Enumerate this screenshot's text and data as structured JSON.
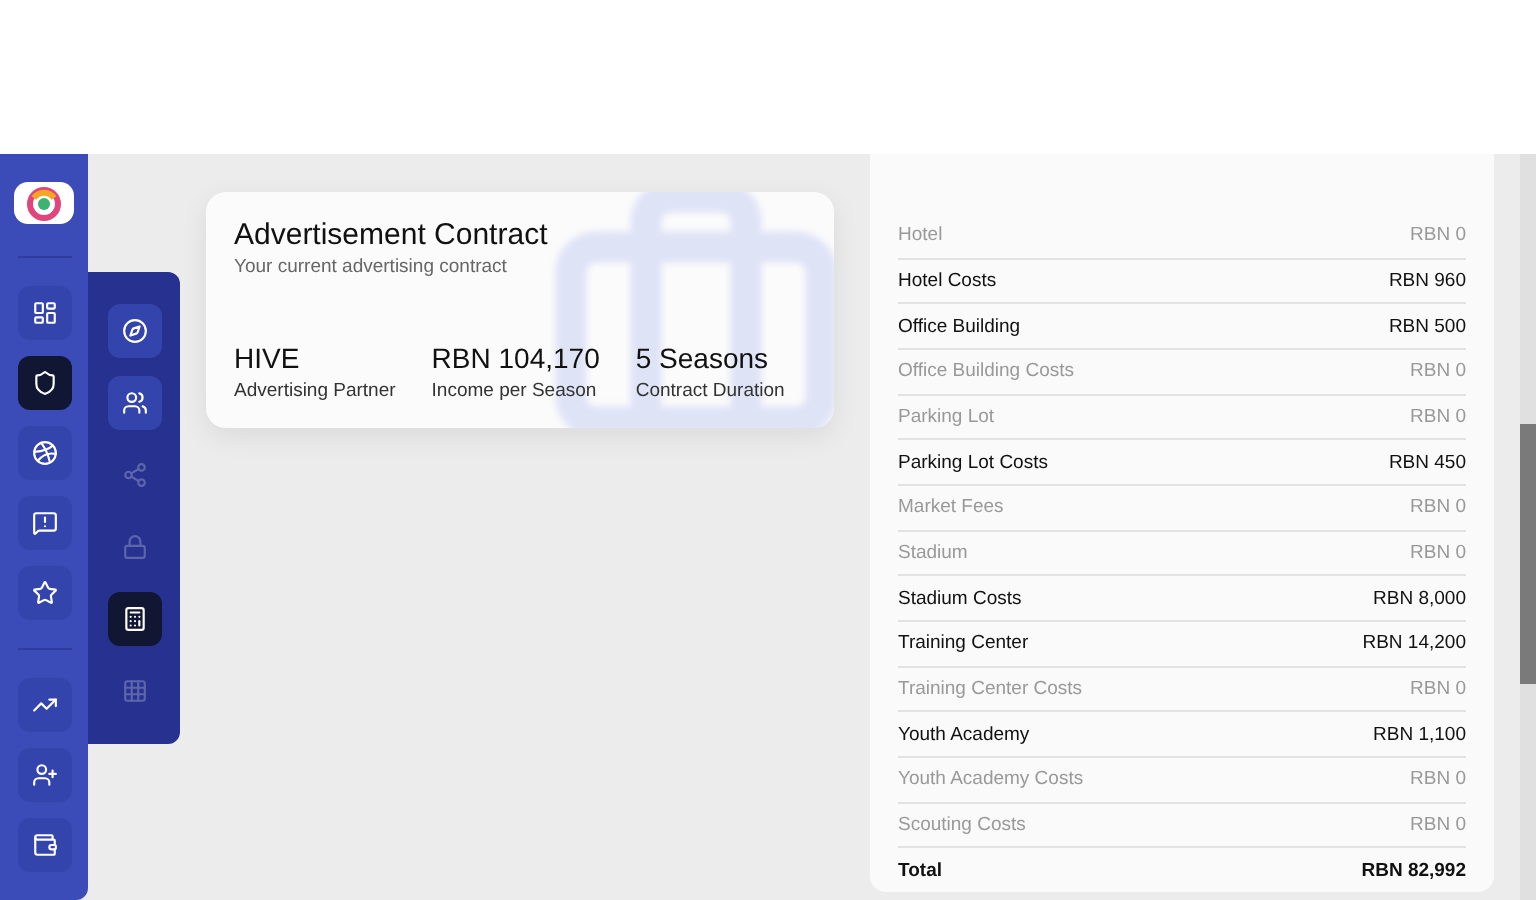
{
  "sidebar": {
    "items": [
      {
        "kind": "dashboard",
        "selected": false
      },
      {
        "kind": "shield",
        "selected": true
      },
      {
        "kind": "ball",
        "selected": false
      },
      {
        "kind": "alert",
        "selected": false
      },
      {
        "kind": "star",
        "selected": false
      },
      {
        "kind": "trend",
        "selected": false
      },
      {
        "kind": "adduser",
        "selected": false
      },
      {
        "kind": "wallet",
        "selected": false
      }
    ]
  },
  "submenu": {
    "items": [
      {
        "kind": "compass",
        "selected": false,
        "disabled": false
      },
      {
        "kind": "users",
        "selected": false,
        "disabled": false
      },
      {
        "kind": "share",
        "selected": false,
        "disabled": true
      },
      {
        "kind": "lock",
        "selected": false,
        "disabled": true
      },
      {
        "kind": "calculator",
        "selected": true,
        "disabled": false
      },
      {
        "kind": "grid",
        "selected": false,
        "disabled": true
      }
    ]
  },
  "contract": {
    "title": "Advertisement Contract",
    "subtitle": "Your current advertising contract",
    "stats": [
      {
        "value": "HIVE",
        "label": "Advertising Partner"
      },
      {
        "value": "RBN 104,170",
        "label": "Income per Season"
      },
      {
        "value": "5 Seasons",
        "label": "Contract Duration"
      }
    ]
  },
  "costs": {
    "rows": [
      {
        "kind": "item",
        "label": "Hotel",
        "value": "RBN 0",
        "dimmed": true
      },
      {
        "kind": "item",
        "label": "Hotel Costs",
        "value": "RBN 960",
        "dimmed": false
      },
      {
        "kind": "item",
        "label": "Office Building",
        "value": "RBN 500",
        "dimmed": false
      },
      {
        "kind": "item",
        "label": "Office Building Costs",
        "value": "RBN 0",
        "dimmed": true
      },
      {
        "kind": "item",
        "label": "Parking Lot",
        "value": "RBN 0",
        "dimmed": true
      },
      {
        "kind": "item",
        "label": "Parking Lot Costs",
        "value": "RBN 450",
        "dimmed": false
      },
      {
        "kind": "item",
        "label": "Market Fees",
        "value": "RBN 0",
        "dimmed": true
      },
      {
        "kind": "item",
        "label": "Stadium",
        "value": "RBN 0",
        "dimmed": true
      },
      {
        "kind": "item",
        "label": "Stadium Costs",
        "value": "RBN 8,000",
        "dimmed": false
      },
      {
        "kind": "item",
        "label": "Training Center",
        "value": "RBN 14,200",
        "dimmed": false
      },
      {
        "kind": "item",
        "label": "Training Center Costs",
        "value": "RBN 0",
        "dimmed": true
      },
      {
        "kind": "item",
        "label": "Youth Academy",
        "value": "RBN 1,100",
        "dimmed": false
      },
      {
        "kind": "item",
        "label": "Youth Academy Costs",
        "value": "RBN 0",
        "dimmed": true
      },
      {
        "kind": "item",
        "label": "Scouting Costs",
        "value": "RBN 0",
        "dimmed": true
      },
      {
        "kind": "total",
        "label": "Total",
        "value": "RBN 82,992",
        "dimmed": false
      }
    ]
  }
}
